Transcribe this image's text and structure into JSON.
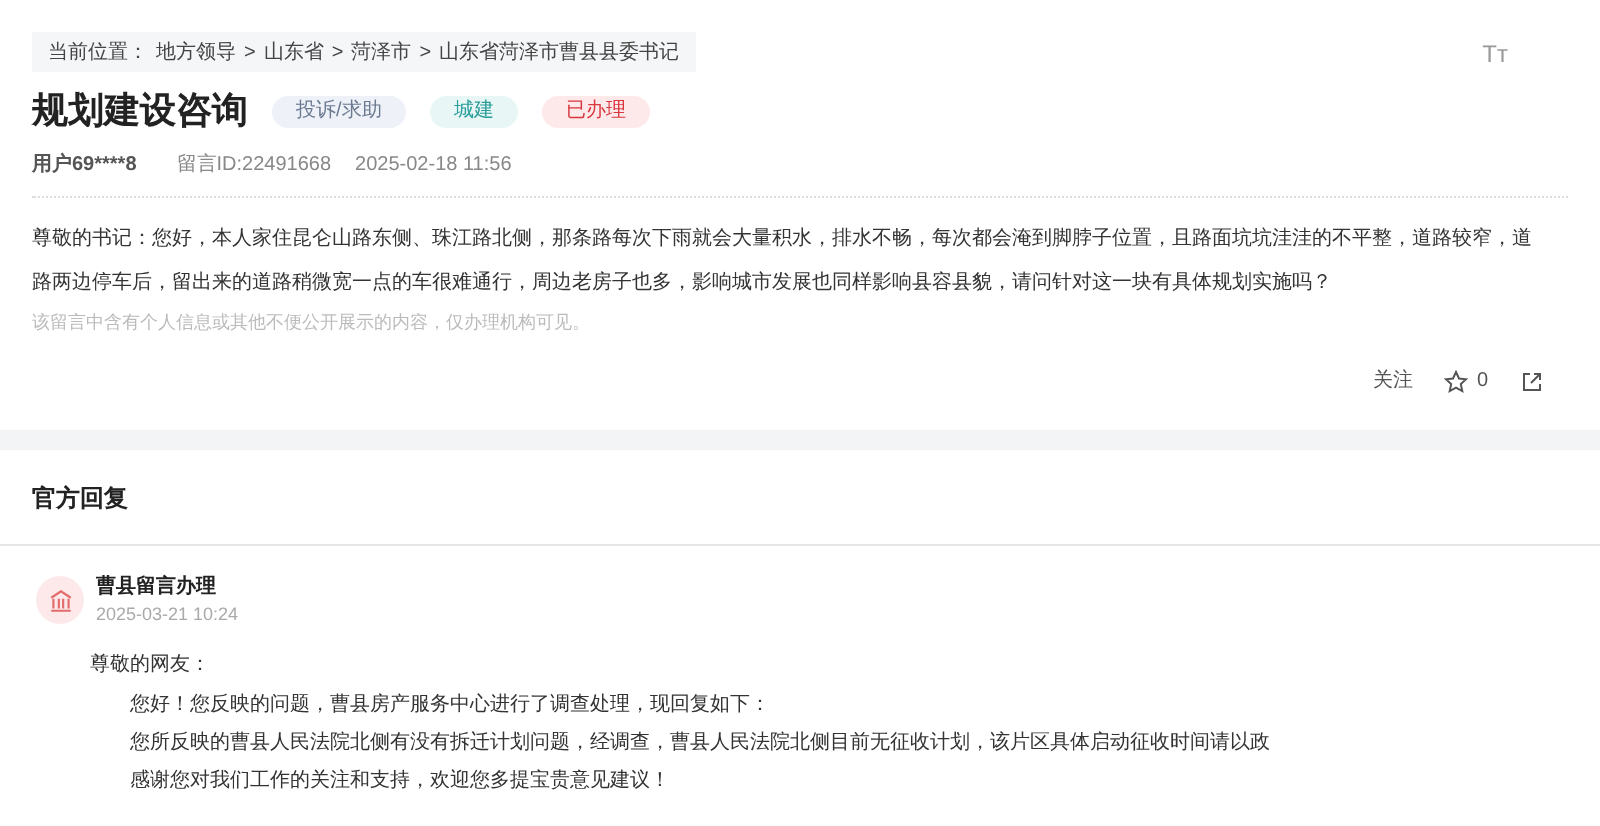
{
  "breadcrumb": {
    "label": "当前位置：",
    "items": [
      "地方领导",
      "山东省",
      "菏泽市",
      "山东省菏泽市曹县县委书记"
    ],
    "separator": ">"
  },
  "font_size_button": "Tт",
  "title": "规划建设咨询",
  "tags": [
    {
      "label": "投诉/求助",
      "kind": "type"
    },
    {
      "label": "城建",
      "kind": "field"
    },
    {
      "label": "已办理",
      "kind": "status"
    }
  ],
  "meta": {
    "user": "用户69****8",
    "message_id": "留言ID:22491668",
    "time": "2025-02-18 11:56"
  },
  "message": "尊敬的书记：您好，本人家住昆仑山路东侧、珠江路北侧，那条路每次下雨就会大量积水，排水不畅，每次都会淹到脚脖子位置，且路面坑坑洼洼的不平整，道路较窄，道路两边停车后，留出来的道路稍微宽一点的车很难通行，周边老房子也多，影响城市发展也同样影响县容县貌，请问针对这一块有具体规划实施吗？",
  "privacy_note": "该留言中含有个人信息或其他不便公开展示的内容，仅办理机构可见。",
  "actions": {
    "follow": "关注",
    "likes": "0"
  },
  "reply_section": {
    "heading": "官方回复",
    "replier": "曹县留言办理",
    "time": "2025-03-21 10:24",
    "greeting": "尊敬的网友：",
    "paragraphs": [
      "您好！您反映的问题，曹县房产服务中心进行了调查处理，现回复如下：",
      "您所反映的曹县人民法院北侧有没有拆迁计划问题，经调查，曹县人民法院北侧目前无征收计划，该片区具体启动征收时间请以政",
      "感谢您对我们工作的关注和支持，欢迎您多提宝贵意见建议！"
    ]
  }
}
